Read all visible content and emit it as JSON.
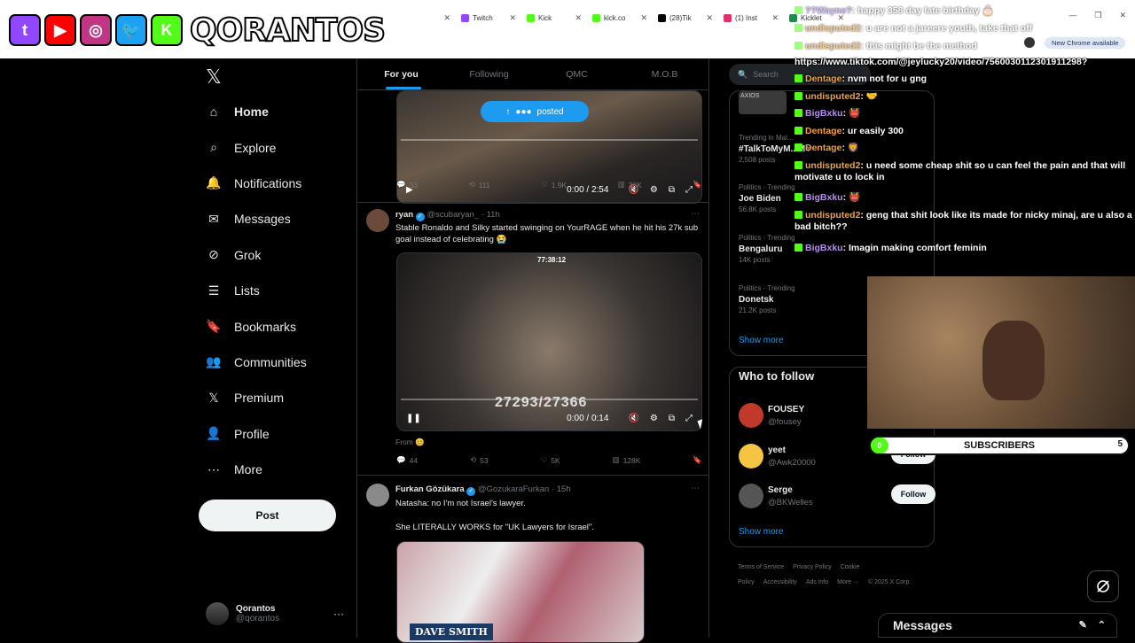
{
  "browser": {
    "tabs": [
      {
        "label": "",
        "color": "#ffffff"
      },
      {
        "label": "Twitch",
        "color": "#9146ff"
      },
      {
        "label": "Kick",
        "color": "#53fc18"
      },
      {
        "label": "kick.co",
        "color": "#53fc18"
      },
      {
        "label": "(28)Tik",
        "color": "#000000"
      },
      {
        "label": "(1) Inst",
        "color": "#e1306c"
      },
      {
        "label": "Kicklet",
        "color": "#1f8a4c"
      }
    ],
    "update_button": "New Chrome available",
    "window_controls": [
      "—",
      "❐",
      "✕"
    ]
  },
  "overlay_banner": {
    "brand": "QORANTOS",
    "socials": [
      {
        "icon": "twitch-icon",
        "glyph": "t",
        "color": "#9146ff"
      },
      {
        "icon": "youtube-icon",
        "glyph": "▶",
        "color": "#ff0000"
      },
      {
        "icon": "instagram-icon",
        "glyph": "◎",
        "color": "#c13584"
      },
      {
        "icon": "twitter-icon",
        "glyph": "🐦",
        "color": "#1da1f2"
      },
      {
        "icon": "kick-icon",
        "glyph": "K",
        "color": "#53fc18"
      }
    ]
  },
  "nav": {
    "items": [
      {
        "label": "Home",
        "icon": "home-icon",
        "active": true
      },
      {
        "label": "Explore",
        "icon": "search-icon"
      },
      {
        "label": "Notifications",
        "icon": "bell-icon"
      },
      {
        "label": "Messages",
        "icon": "mail-icon"
      },
      {
        "label": "Grok",
        "icon": "grok-icon"
      },
      {
        "label": "Lists",
        "icon": "list-icon"
      },
      {
        "label": "Bookmarks",
        "icon": "bookmark-icon"
      },
      {
        "label": "Communities",
        "icon": "communities-icon"
      },
      {
        "label": "Premium",
        "icon": "x-icon"
      },
      {
        "label": "Profile",
        "icon": "person-icon"
      },
      {
        "label": "More",
        "icon": "more-icon"
      }
    ],
    "post_label": "Post",
    "account": {
      "name": "Qorantos",
      "handle": "@qorantos",
      "more": "···"
    }
  },
  "timeline": {
    "tabs": [
      "For you",
      "Following",
      "QMC",
      "M.O.B"
    ],
    "tweet1": {
      "posted_label": "posted",
      "video_time": "0:00 / 2:54",
      "stats": {
        "replies": "33",
        "reposts": "111",
        "likes": "1.9K",
        "views": "38K"
      }
    },
    "tweet2": {
      "name": "ryan",
      "handle": "@scubaryan_",
      "time": "11h",
      "text": "Stable Ronaldo and Silky started swinging on YourRAGE when he hit his 27k sub goal instead of celebrating 😭",
      "overlay_counter": "27293/27366",
      "overlay_small": "77:38:12",
      "video_time": "0:00 / 0:14",
      "from_label": "From",
      "stats": {
        "replies": "44",
        "reposts": "53",
        "likes": "5K",
        "views": "128K"
      }
    },
    "tweet3": {
      "name": "Furkan Gözükara",
      "handle": "@GozukaraFurkan",
      "time": "15h",
      "text1": "Natasha: no I'm not Israel's lawyer.",
      "text2": "She LITERALLY WORKS for \"UK Lawyers for Israel\".",
      "caption": "DAVE SMITH"
    }
  },
  "sidebar": {
    "search_placeholder": "Search",
    "trends": [
      {
        "meta": "Trending in Mal...",
        "name": "#TalkToMyM...MY",
        "count": "2,508 posts"
      },
      {
        "meta": "Politics · Trending",
        "name": "Joe Biden",
        "count": "56.8K posts"
      },
      {
        "meta": "Politics · Trending",
        "name": "Bengaluru",
        "count": "14K posts"
      },
      {
        "meta": "Politics · Trending",
        "name": "Donetsk",
        "count": "21.2K posts"
      }
    ],
    "trend_top_label": "AXIOS",
    "show_more": "Show more",
    "who_to_follow": {
      "title": "Who to follow",
      "users": [
        {
          "name": "FOUSEY",
          "handle": "@fousey",
          "color": "#c0392b"
        },
        {
          "name": "yeet",
          "handle": "@Awk20000",
          "color": "#f4c542"
        },
        {
          "name": "Serge",
          "handle": "@BKWelles",
          "color": "#555555"
        }
      ],
      "follow_label": "Follow",
      "show_more": "Show more"
    },
    "footer": [
      "Terms of Service",
      "Privacy Policy",
      "Cookie Policy",
      "Accessibility",
      "Ads info",
      "More ···",
      "© 2025 X Corp."
    ]
  },
  "messages_drawer": {
    "title": "Messages"
  },
  "chat": {
    "lines": [
      {
        "user": "??Wayne?",
        "text": ": happy 358 day late birthday 🎂",
        "color": "purple",
        "faded": true
      },
      {
        "user": "undisputed2",
        "text": ": u are not a jareere youth, take that off",
        "color": "orange",
        "faded": true
      },
      {
        "user": "undisputed2",
        "text": ": this might be the method",
        "color": "orange",
        "faded": true
      },
      {
        "user": "",
        "text": "https://www.tiktok.com/@jeylucky20/video/7560030112301911298?",
        "color": "none",
        "faded": false
      },
      {
        "user": "Dentage",
        "text": ": nvm not for u gng",
        "color": "orange",
        "faded": false
      },
      {
        "user": "undisputed2",
        "text": ": 🤝",
        "color": "orange",
        "faded": false
      },
      {
        "user": "BigBxku",
        "text": ": 👹",
        "color": "purple",
        "faded": false
      },
      {
        "user": "Dentage",
        "text": ": ur easily 300",
        "color": "orange",
        "faded": false
      },
      {
        "user": "Dentage",
        "text": ": 🦁",
        "color": "orange",
        "faded": false
      },
      {
        "user": "undisputed2",
        "text": ": u need some cheap shit so u can feel the pain and that will motivate u to lock in",
        "color": "orange",
        "faded": false
      },
      {
        "user": "BigBxku",
        "text": ": 👹",
        "color": "purple",
        "faded": false
      },
      {
        "user": "undisputed2",
        "text": ": geng that shit look like its made for nicky minaj, are u also a bad bitch??",
        "color": "orange",
        "faded": false
      },
      {
        "user": "BigBxku",
        "text": ": Imagin making comfort feminin",
        "color": "purple",
        "faded": false
      }
    ]
  },
  "subs": {
    "start": "0",
    "label": "SUBSCRIBERS",
    "goal": "5",
    "progress": 0
  }
}
